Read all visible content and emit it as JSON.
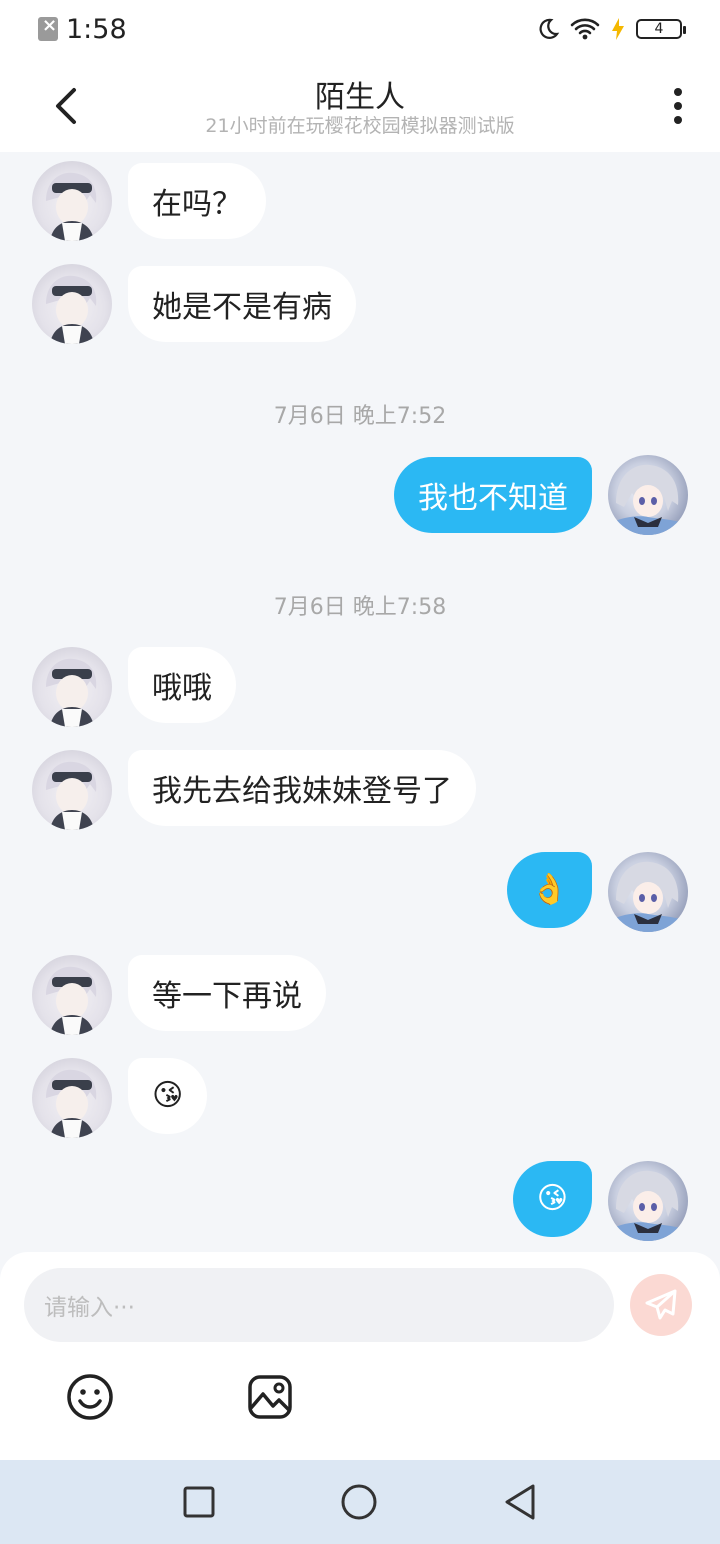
{
  "status_bar": {
    "time": "1:58",
    "battery": "4"
  },
  "header": {
    "title": "陌生人",
    "subtitle": "21小时前在玩樱花校园模拟器测试版"
  },
  "messages": [
    {
      "type": "in",
      "text": "在吗？"
    },
    {
      "type": "in",
      "text": "她是不是有病"
    },
    {
      "type": "time",
      "text": "7月6日 晚上7:52"
    },
    {
      "type": "out",
      "text": "我也不知道"
    },
    {
      "type": "time",
      "text": "7月6日 晚上7:58"
    },
    {
      "type": "in",
      "text": "哦哦"
    },
    {
      "type": "in",
      "text": "我先去给我妹妹登号了"
    },
    {
      "type": "out",
      "text": "👌"
    },
    {
      "type": "in",
      "text": "等一下再说"
    },
    {
      "type": "in",
      "text": "😘"
    },
    {
      "type": "out",
      "text": "😘"
    }
  ],
  "input": {
    "placeholder": "请输入···"
  },
  "colors": {
    "accent": "#2bb8f3",
    "background": "#f4f6f9",
    "send_button": "#fbd9d3"
  },
  "icons": {
    "back": "back-arrow-icon",
    "more": "more-vertical-icon",
    "send": "send-icon",
    "emoji": "emoji-icon",
    "image": "image-icon"
  }
}
